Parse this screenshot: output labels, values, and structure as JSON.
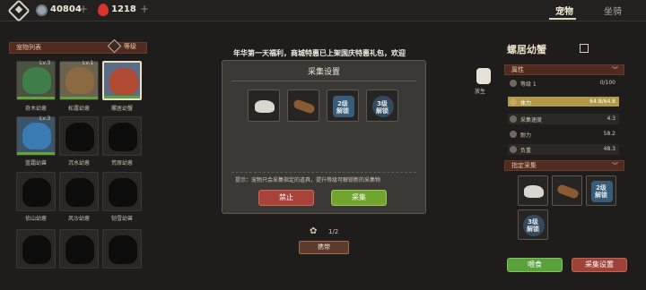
{
  "topbar": {
    "coins": "40804",
    "gems": "1218",
    "tab_pets": "宠物",
    "tab_mounts": "坐骑"
  },
  "left": {
    "list_title": "宠物列表",
    "sort_label": "等级",
    "pets": [
      {
        "name": "奇木幼崽",
        "level": "Lv.3"
      },
      {
        "name": "松露幼崽",
        "level": "Lv.1"
      },
      {
        "name": "螺居幼蟹",
        "level": ""
      },
      {
        "name": "蓝霜幼兽",
        "level": "Lv.3"
      },
      {
        "name": "沉水幼崽",
        "level": ""
      },
      {
        "name": "荒原幼崽",
        "level": ""
      },
      {
        "name": "侦山幼崽",
        "level": ""
      },
      {
        "name": "风沙幼崽",
        "level": ""
      },
      {
        "name": "铠雪幼兽",
        "level": ""
      }
    ]
  },
  "center": {
    "announcement": "年华第一天福利，商城特惠已上架国庆特惠礼包，欢迎",
    "modal": {
      "title": "采集设置",
      "tool3_locked": "2级\n解锁",
      "tool4_locked": "3级\n解锁",
      "hint": "提示：宠物只会采集指定的道具，提升等级可解锁新的采集物",
      "forbid_label": "禁止",
      "collect_label": "采集"
    },
    "page": "1/2",
    "carry_label": "携带"
  },
  "side": {
    "release_label": "放生"
  },
  "right": {
    "pet_name": "螺居幼蟹",
    "attr_title": "属性",
    "stats": [
      {
        "label": "等级 1",
        "value": "0/100"
      },
      {
        "label": "体力",
        "value": "64.8/64.8"
      },
      {
        "label": "采集速度",
        "value": "4.3"
      },
      {
        "label": "耐力",
        "value": "58.2"
      },
      {
        "label": "负重",
        "value": "48.3"
      }
    ],
    "collect_title": "指定采集",
    "rtool3_locked": "2级\n解锁",
    "rtool4_locked": "3级\n解锁",
    "feed_label": "喂食",
    "settings_label": "采集设置"
  },
  "colors": {
    "accent_green": "#72a52f",
    "accent_red": "#a8433a",
    "header_brown": "#4f2b20"
  }
}
